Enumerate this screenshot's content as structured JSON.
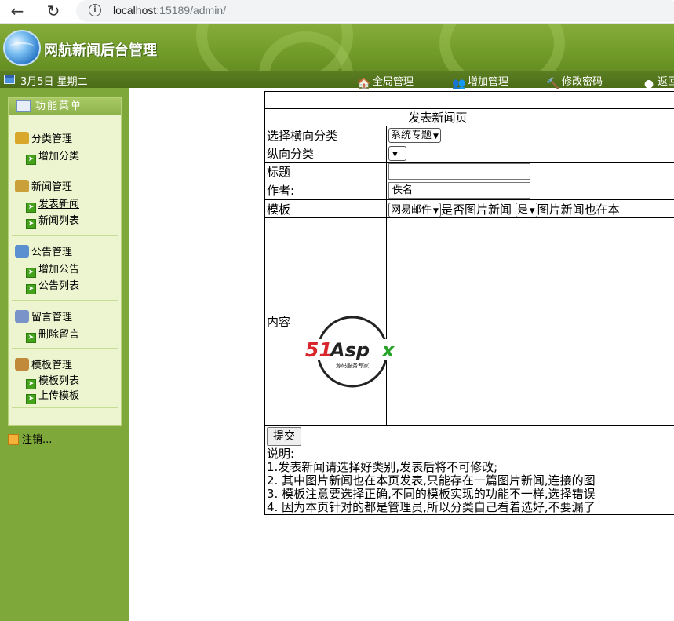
{
  "browser": {
    "url_host": "localhost",
    "url_rest": ":15189/admin/",
    "icons": {
      "back": "arrow-left-icon",
      "reload": "reload-icon",
      "info": "info-icon"
    }
  },
  "header": {
    "site_title": "网航新闻后台管理"
  },
  "topbar": {
    "date": "3月5日 星期二",
    "nav": [
      {
        "label": "全局管理",
        "icon": "home-icon"
      },
      {
        "label": "增加管理",
        "icon": "users-icon"
      },
      {
        "label": "修改密码",
        "icon": "tools-icon"
      },
      {
        "label": "返回",
        "icon": "return-icon"
      }
    ]
  },
  "sidebar": {
    "title": "功能菜单",
    "groups": [
      {
        "label": "分类管理",
        "items": [
          "增加分类"
        ]
      },
      {
        "label": "新闻管理",
        "items": [
          "发表新闻",
          "新闻列表"
        ]
      },
      {
        "label": "公告管理",
        "items": [
          "增加公告",
          "公告列表"
        ]
      },
      {
        "label": "留言管理",
        "items": [
          "删除留言"
        ]
      },
      {
        "label": "模板管理",
        "items": [
          "模板列表",
          "上传模板"
        ]
      }
    ],
    "logout": "注销..."
  },
  "form": {
    "page_title": "发表新闻页",
    "rows": {
      "category_h": {
        "label": "选择横向分类",
        "value": "系统专题"
      },
      "category_v": {
        "label": "纵向分类",
        "value": ""
      },
      "title": {
        "label": "标题",
        "value": ""
      },
      "author": {
        "label": "作者:",
        "value": "佚名"
      },
      "template": {
        "label": "模板",
        "template_value": "网易邮件",
        "is_image_text": "是否图片新闻",
        "is_image_value": "是",
        "trailing_text": "图片新闻也在本"
      },
      "content": {
        "label": "内容"
      }
    },
    "submit_label": "提交",
    "notes": [
      "说明:",
      "1.发表新闻请选择好类别,发表后将不可修改;",
      "2.  其中图片新闻也在本页发表,只能存在一篇图片新闻,连接的图",
      "3.  模板注意要选择正确,不同的模板实现的功能不一样,选择错误",
      "4.  因为本页针对的都是管理员,所以分类自己看着选好,不要漏了"
    ]
  },
  "watermark": {
    "brand": "51Aspx",
    "tagline": "源码服务专家"
  }
}
